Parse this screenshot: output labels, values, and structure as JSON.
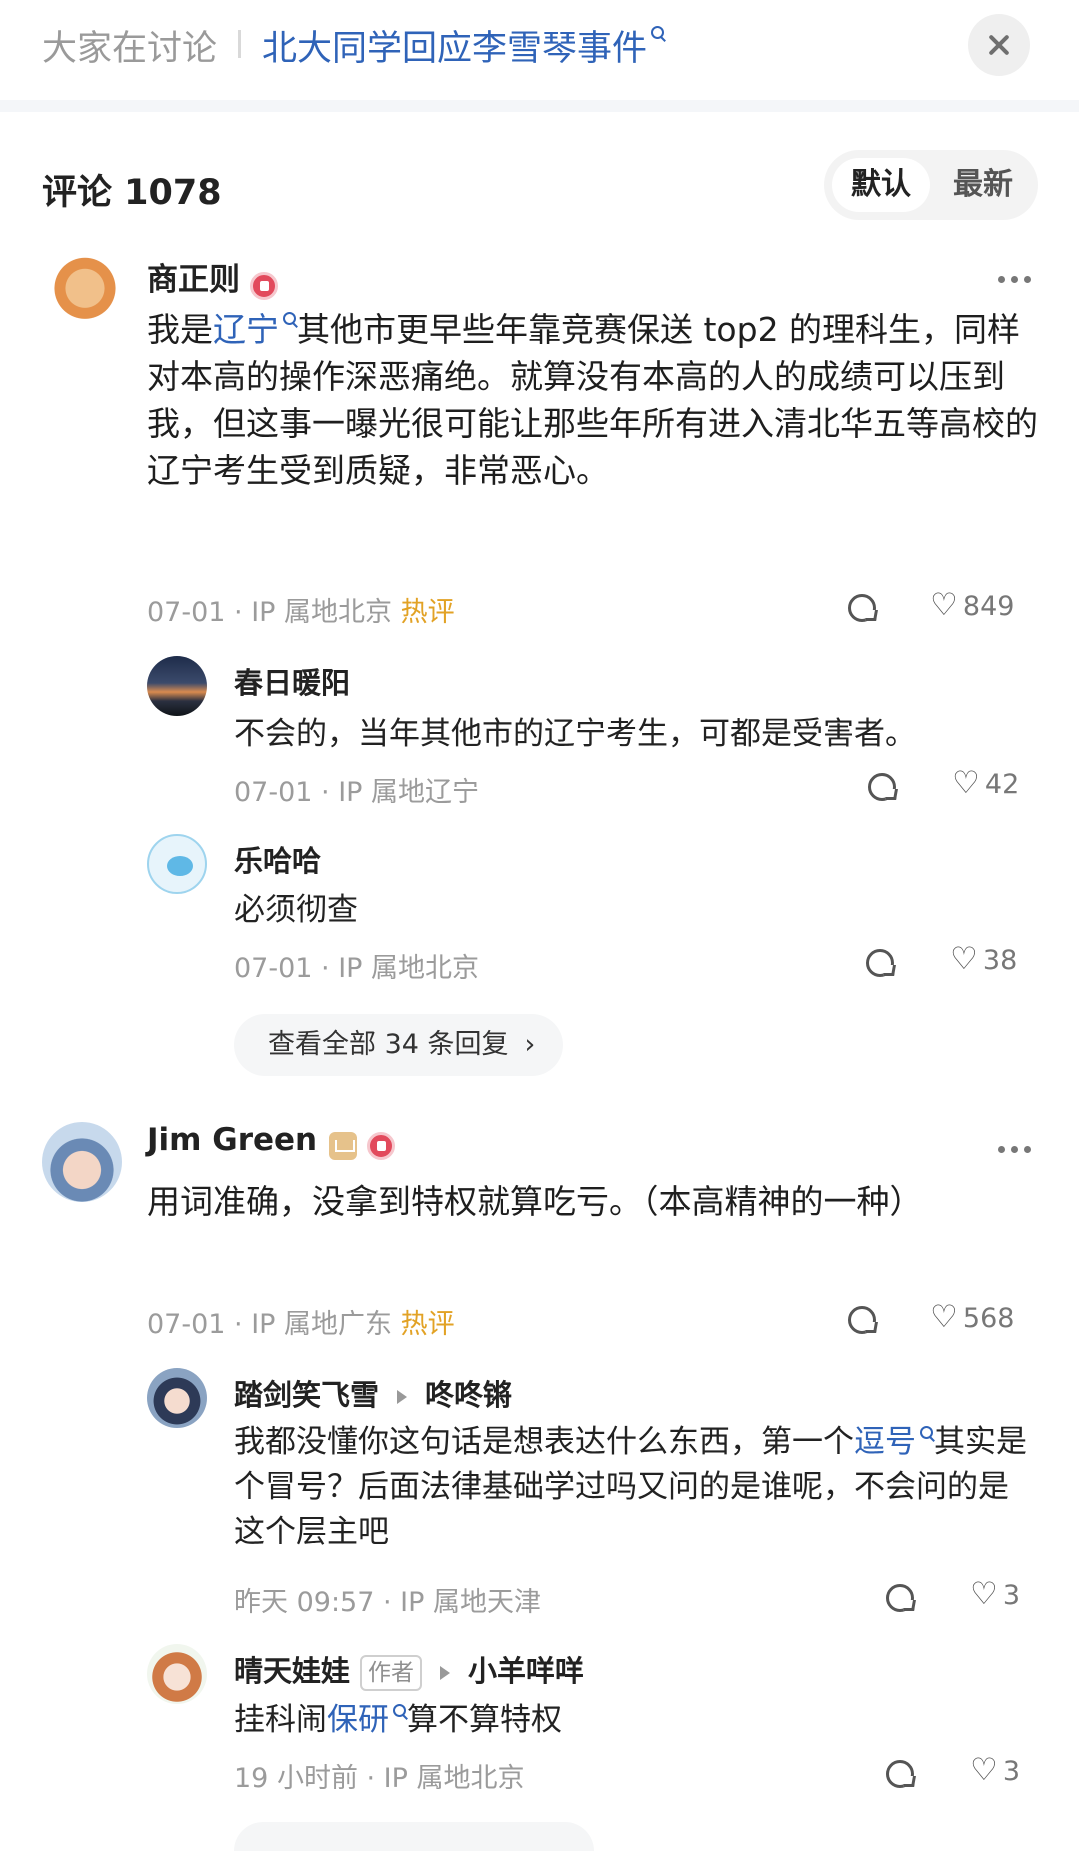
{
  "header": {
    "left_label": "大家在讨论",
    "topic": "北大同学回应李雪琴事件"
  },
  "comments_header": {
    "title": "评论 1078",
    "sort": [
      "默认",
      "最新"
    ]
  },
  "comments": [
    {
      "user": "商正则",
      "body_parts": [
        "我是",
        "辽宁",
        "其他市更早些年靠竞赛保送 top2 的理科生，同样对本高的操作深恶痛绝。就算没有本高的人的成绩可以压到我，但这事一曝光很可能让那些年所有进入清北华五等高校的辽宁考生受到质疑，非常恶心。"
      ],
      "meta": "07-01 · IP 属地北京",
      "hot": "热评",
      "likes": "849",
      "replies": [
        {
          "user": "春日暖阳",
          "text": "不会的，当年其他市的辽宁考生，可都是受害者。",
          "meta": "07-01 · IP 属地辽宁",
          "likes": "42"
        },
        {
          "user": "乐哈哈",
          "text": "必须彻查",
          "meta": "07-01 · IP 属地北京",
          "likes": "38"
        }
      ],
      "view_all": "查看全部 34 条回复"
    },
    {
      "user": "Jim Green",
      "body": "用词准确，没拿到特权就算吃亏。（本高精神的一种）",
      "meta": "07-01 · IP 属地广东",
      "hot": "热评",
      "likes": "568",
      "replies": [
        {
          "user": "踏剑笑飞雪",
          "reply_to": "咚咚锵",
          "text_parts": [
            "我都没懂你这句话是想表达什么东西，第一个",
            "逗号",
            "其实是个冒号？后面法律基础学过吗又问的是谁呢，不会问的是这个层主吧"
          ],
          "meta": "昨天 09:57 · IP 属地天津",
          "likes": "3"
        },
        {
          "user": "晴天娃娃",
          "tag": "作者",
          "reply_to": "小羊咩咩",
          "text_parts": [
            "挂科闹",
            "保研",
            "算不算特权"
          ],
          "meta": "19 小时前 · IP 属地北京",
          "likes": "3"
        }
      ]
    }
  ]
}
